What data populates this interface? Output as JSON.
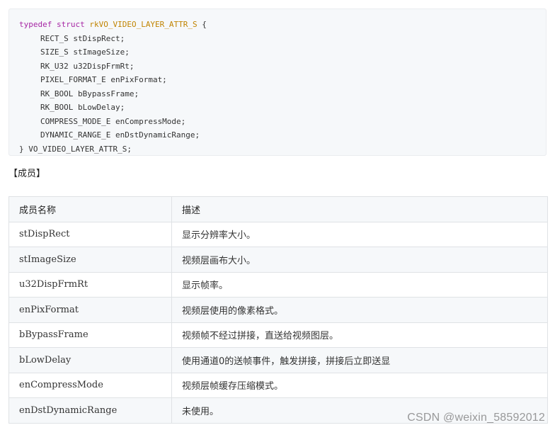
{
  "code": {
    "lines": [
      {
        "keyword": "typedef struct",
        "type_name": "rkVO_VIDEO_LAYER_ATTR_S",
        "rest": " {"
      },
      {
        "text": "RECT_S stDispRect;"
      },
      {
        "text": "SIZE_S stImageSize;"
      },
      {
        "text": "RK_U32 u32DispFrmRt;"
      },
      {
        "text": "PIXEL_FORMAT_E enPixFormat;"
      },
      {
        "text": "RK_BOOL bBypassFrame;"
      },
      {
        "text": "RK_BOOL bLowDelay;"
      },
      {
        "text": "COMPRESS_MODE_E enCompressMode;"
      },
      {
        "text": "DYNAMIC_RANGE_E enDstDynamicRange;"
      },
      {
        "text": "} VO_VIDEO_LAYER_ATTR_S;"
      }
    ]
  },
  "section_title": "【成员】",
  "table": {
    "headers": [
      "成员名称",
      "描述"
    ],
    "rows": [
      {
        "name": "stDispRect",
        "desc": "显示分辨率大小。"
      },
      {
        "name": "stImageSize",
        "desc": "视频层画布大小。"
      },
      {
        "name": "u32DispFrmRt",
        "desc": "显示帧率。"
      },
      {
        "name": "enPixFormat",
        "desc": "视频层使用的像素格式。"
      },
      {
        "name": "bBypassFrame",
        "desc": "视频帧不经过拼接，直送给视频图层。"
      },
      {
        "name": "bLowDelay",
        "desc": "使用通道0的送帧事件，触发拼接，拼接后立即送显"
      },
      {
        "name": "enCompressMode",
        "desc": "视频层帧缓存压缩模式。"
      },
      {
        "name": "enDstDynamicRange",
        "desc": "未使用。"
      }
    ]
  },
  "watermark": "CSDN @weixin_58592012"
}
